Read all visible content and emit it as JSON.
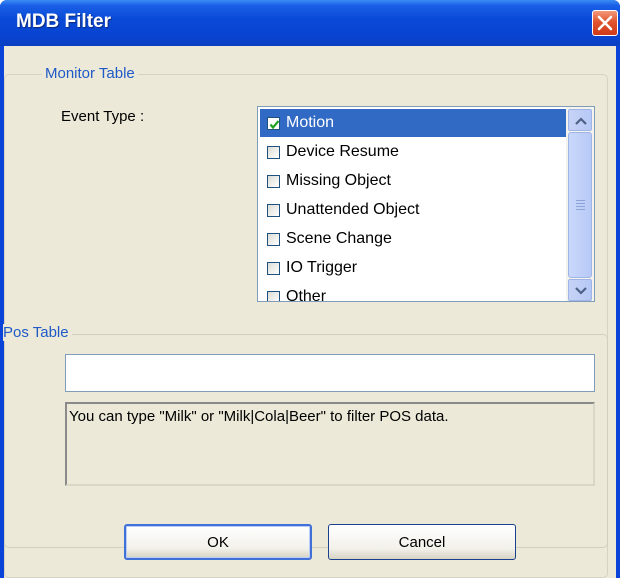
{
  "window": {
    "title": "MDB Filter"
  },
  "monitor": {
    "legend": "Monitor Table",
    "event_type_label": "Event Type :",
    "items": [
      {
        "label": "Motion",
        "checked": true,
        "selected": true
      },
      {
        "label": "Device Resume",
        "checked": false,
        "selected": false
      },
      {
        "label": "Missing Object",
        "checked": false,
        "selected": false
      },
      {
        "label": "Unattended Object",
        "checked": false,
        "selected": false
      },
      {
        "label": "Scene Change",
        "checked": false,
        "selected": false
      },
      {
        "label": "IO Trigger",
        "checked": false,
        "selected": false
      },
      {
        "label": "Other",
        "checked": false,
        "selected": false
      }
    ]
  },
  "pos": {
    "legend": "Pos Table",
    "input_value": "",
    "hint": "You can type \"Milk\" or \"Milk|Cola|Beer\" to filter POS data."
  },
  "buttons": {
    "ok": "OK",
    "cancel": "Cancel"
  },
  "colors": {
    "title_bar": "#0a43d8",
    "selection": "#316ac5",
    "legend_text": "#1f5ac8",
    "face": "#ece9d8"
  }
}
